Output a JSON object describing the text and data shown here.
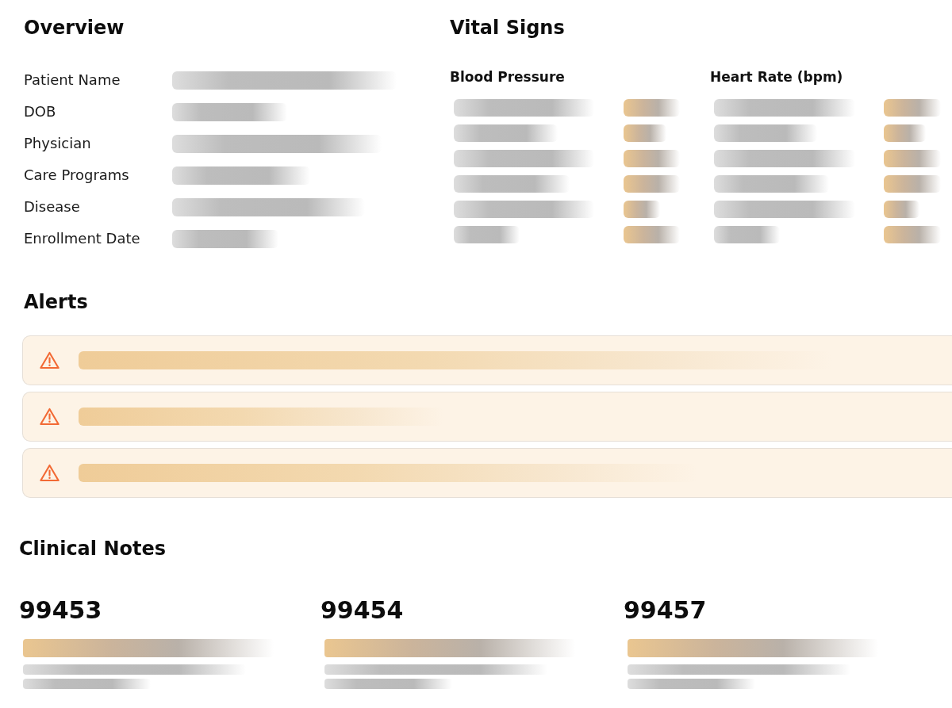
{
  "overview": {
    "title": "Overview",
    "fields": [
      {
        "label": "Patient Name"
      },
      {
        "label": "DOB"
      },
      {
        "label": "Physician"
      },
      {
        "label": "Care Programs"
      },
      {
        "label": "Disease"
      },
      {
        "label": "Enrollment Date"
      }
    ]
  },
  "vital_signs": {
    "title": "Vital Signs",
    "groups": [
      {
        "title": "Blood Pressure"
      },
      {
        "title": "Heart Rate (bpm)"
      }
    ]
  },
  "alerts": {
    "title": "Alerts",
    "items": [
      {
        "kind": "warning"
      },
      {
        "kind": "warning"
      },
      {
        "kind": "warning"
      }
    ]
  },
  "clinical_notes": {
    "title": "Clinical Notes",
    "notes": [
      {
        "code": "99453"
      },
      {
        "code": "99454"
      },
      {
        "code": "99457"
      }
    ]
  }
}
